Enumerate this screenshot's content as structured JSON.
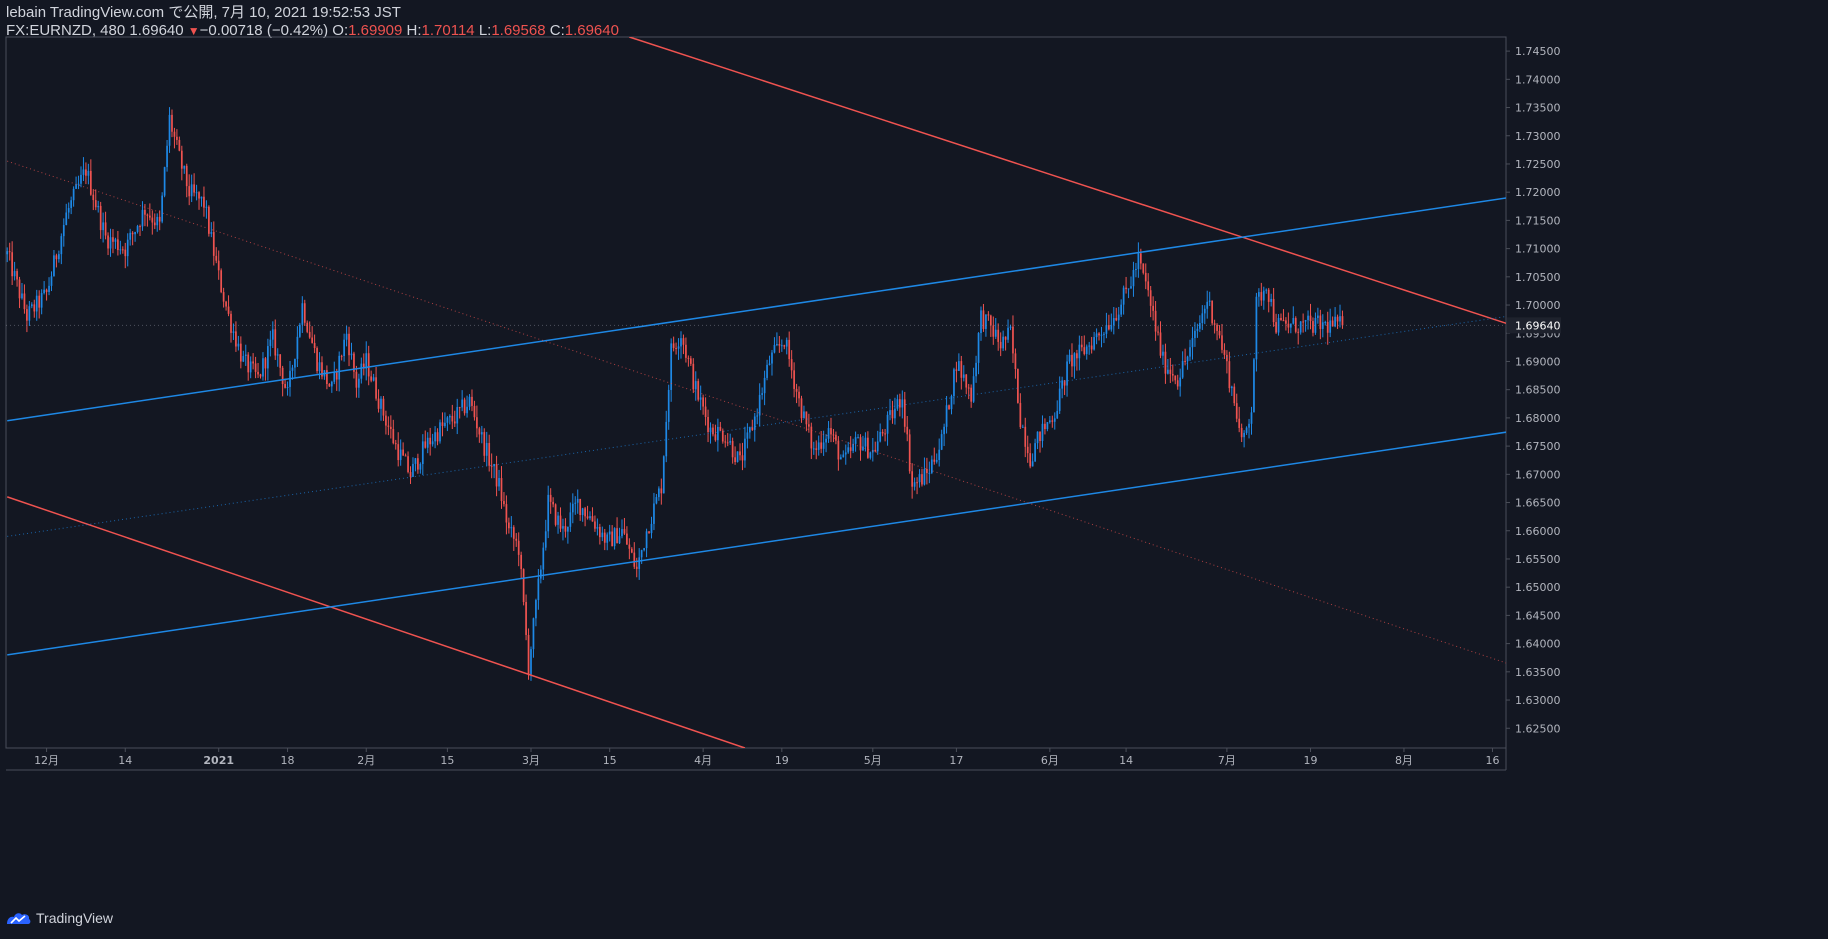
{
  "header": {
    "publisher": "lebain TradingView.com で公開, 7月 10, 2021 19:52:53 JST",
    "symbol": "FX:EURNZD, 480",
    "last": "1.69640",
    "change": "−0.00718 (−0.42%)",
    "o_label": "O:",
    "o_value": "1.69909",
    "h_label": "H:",
    "h_value": "1.70114",
    "l_label": "L:",
    "l_value": "1.69568",
    "c_label": "C:",
    "c_value": "1.69640"
  },
  "footer": {
    "brand": "TradingView"
  },
  "colors": {
    "background": "#131722",
    "up": "#1e88e5",
    "down": "#ef5350",
    "axis_text": "#b2b5be",
    "grid_border": "#4a4e59"
  },
  "chart_data": {
    "type": "candlestick",
    "symbol": "FX:EURNZD",
    "interval": "480",
    "ylim": [
      1.6215,
      1.7475
    ],
    "y_ticks": [
      "1.74500",
      "1.74000",
      "1.73500",
      "1.73000",
      "1.72500",
      "1.72000",
      "1.71500",
      "1.71000",
      "1.70500",
      "1.70000",
      "1.69500",
      "1.69000",
      "1.68500",
      "1.68000",
      "1.67500",
      "1.67000",
      "1.66500",
      "1.66000",
      "1.65500",
      "1.65000",
      "1.64500",
      "1.64000",
      "1.63500",
      "1.63000",
      "1.62500"
    ],
    "y_tick_values": [
      1.745,
      1.74,
      1.735,
      1.73,
      1.725,
      1.72,
      1.715,
      1.71,
      1.705,
      1.7,
      1.695,
      1.69,
      1.685,
      1.68,
      1.675,
      1.67,
      1.665,
      1.66,
      1.655,
      1.65,
      1.645,
      1.64,
      1.635,
      1.63,
      1.625
    ],
    "last_price": 1.6964,
    "last_price_label": "1.69640",
    "x_ticks": [
      "12月",
      "14",
      "2021",
      "18",
      "2月",
      "15",
      "3月",
      "15",
      "4月",
      "19",
      "5月",
      "17",
      "6月",
      "14",
      "7月",
      "19",
      "8月",
      "16"
    ],
    "x_tick_bars": [
      16,
      48,
      86,
      114,
      146,
      179,
      213,
      245,
      283,
      315,
      352,
      386,
      424,
      455,
      496,
      530,
      568,
      604
    ],
    "total_bars": 610,
    "bars_visible": 543,
    "close_path": [
      [
        0,
        1.709
      ],
      [
        8,
        1.698
      ],
      [
        16,
        1.702
      ],
      [
        24,
        1.716
      ],
      [
        32,
        1.724
      ],
      [
        40,
        1.712
      ],
      [
        48,
        1.71
      ],
      [
        56,
        1.717
      ],
      [
        62,
        1.714
      ],
      [
        66,
        1.733
      ],
      [
        70,
        1.726
      ],
      [
        74,
        1.72
      ],
      [
        80,
        1.718
      ],
      [
        86,
        1.705
      ],
      [
        90,
        1.698
      ],
      [
        96,
        1.69
      ],
      [
        102,
        1.687
      ],
      [
        108,
        1.694
      ],
      [
        114,
        1.684
      ],
      [
        120,
        1.7
      ],
      [
        126,
        1.69
      ],
      [
        132,
        1.685
      ],
      [
        138,
        1.695
      ],
      [
        142,
        1.686
      ],
      [
        146,
        1.69
      ],
      [
        152,
        1.682
      ],
      [
        158,
        1.675
      ],
      [
        164,
        1.67
      ],
      [
        170,
        1.675
      ],
      [
        176,
        1.678
      ],
      [
        182,
        1.68
      ],
      [
        188,
        1.683
      ],
      [
        194,
        1.675
      ],
      [
        200,
        1.668
      ],
      [
        204,
        1.66
      ],
      [
        208,
        1.657
      ],
      [
        212,
        1.636
      ],
      [
        216,
        1.65
      ],
      [
        220,
        1.665
      ],
      [
        226,
        1.66
      ],
      [
        232,
        1.665
      ],
      [
        238,
        1.662
      ],
      [
        244,
        1.658
      ],
      [
        250,
        1.66
      ],
      [
        256,
        1.653
      ],
      [
        260,
        1.66
      ],
      [
        266,
        1.668
      ],
      [
        270,
        1.692
      ],
      [
        274,
        1.695
      ],
      [
        280,
        1.685
      ],
      [
        286,
        1.678
      ],
      [
        292,
        1.677
      ],
      [
        298,
        1.672
      ],
      [
        304,
        1.68
      ],
      [
        310,
        1.69
      ],
      [
        316,
        1.694
      ],
      [
        322,
        1.683
      ],
      [
        328,
        1.674
      ],
      [
        334,
        1.678
      ],
      [
        340,
        1.672
      ],
      [
        346,
        1.676
      ],
      [
        352,
        1.674
      ],
      [
        358,
        1.679
      ],
      [
        364,
        1.684
      ],
      [
        368,
        1.668
      ],
      [
        374,
        1.67
      ],
      [
        380,
        1.676
      ],
      [
        386,
        1.69
      ],
      [
        392,
        1.684
      ],
      [
        396,
        1.698
      ],
      [
        400,
        1.696
      ],
      [
        404,
        1.693
      ],
      [
        408,
        1.695
      ],
      [
        412,
        1.68
      ],
      [
        416,
        1.673
      ],
      [
        420,
        1.677
      ],
      [
        426,
        1.681
      ],
      [
        432,
        1.69
      ],
      [
        438,
        1.692
      ],
      [
        444,
        1.695
      ],
      [
        450,
        1.698
      ],
      [
        456,
        1.703
      ],
      [
        460,
        1.708
      ],
      [
        464,
        1.702
      ],
      [
        470,
        1.69
      ],
      [
        476,
        1.687
      ],
      [
        482,
        1.693
      ],
      [
        488,
        1.701
      ],
      [
        492,
        1.696
      ],
      [
        496,
        1.689
      ],
      [
        500,
        1.681
      ],
      [
        502,
        1.675
      ],
      [
        506,
        1.682
      ],
      [
        508,
        1.7
      ],
      [
        512,
        1.704
      ],
      [
        516,
        1.6964
      ]
    ],
    "trendlines": [
      {
        "color": "#ef5350",
        "width": 1.5,
        "p1": [
          253,
          1.7475
        ],
        "p2": [
          610,
          1.6967
        ]
      },
      {
        "color": "#ef5350",
        "width": 1.5,
        "p1": [
          0,
          1.666
        ],
        "p2": [
          300,
          1.6215
        ]
      },
      {
        "color": "#1e88e5",
        "width": 1.5,
        "p1": [
          0,
          1.6795
        ],
        "p2": [
          610,
          1.719
        ]
      },
      {
        "color": "#1e88e5",
        "width": 1.5,
        "p1": [
          0,
          1.638
        ],
        "p2": [
          610,
          1.6775
        ]
      },
      {
        "color": "#ef5350",
        "width": 1,
        "dotted": true,
        "p1": [
          0,
          1.7255
        ],
        "p2": [
          610,
          1.6365
        ]
      },
      {
        "color": "#1e88e5",
        "width": 1,
        "dotted": true,
        "p1": [
          0,
          1.659
        ],
        "p2": [
          610,
          1.698
        ]
      }
    ]
  }
}
